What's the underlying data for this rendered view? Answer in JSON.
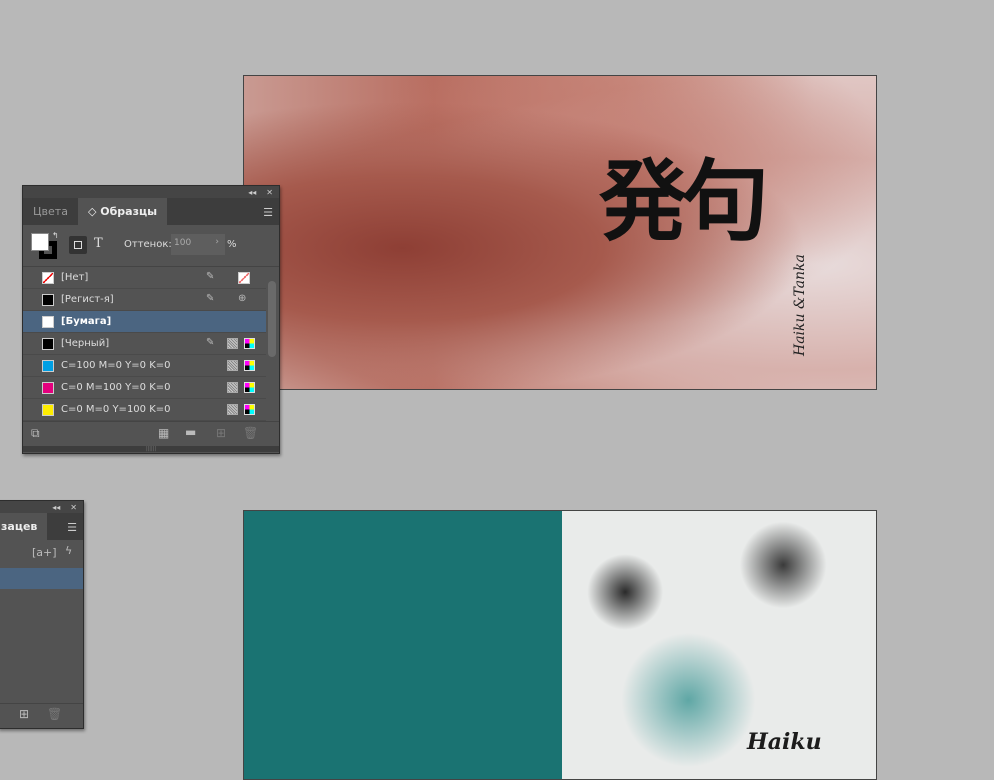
{
  "swatches_panel": {
    "tabs": [
      "Цвета",
      "Образцы"
    ],
    "tint_label": "Оттенок:",
    "tint_value": "100",
    "percent": "%",
    "swatches": [
      {
        "name": "[Нет]",
        "color": "none"
      },
      {
        "name": "[Регист-я]",
        "color": "#000000"
      },
      {
        "name": "[Бумага]",
        "color": "#ffffff",
        "selected": true
      },
      {
        "name": "[Черный]",
        "color": "#000000"
      },
      {
        "name": "C=100 M=0 Y=0 K=0",
        "color": "#009fe3"
      },
      {
        "name": "C=0 M=100 Y=0 K=0",
        "color": "#e5007e"
      },
      {
        "name": "C=0 M=0 Y=100 K=0",
        "color": "#ffed00"
      }
    ]
  },
  "paragraph_panel": {
    "tab": "зацев",
    "new_style_icon": "[a+]"
  },
  "artwork": {
    "kanji": "発句",
    "vertical_text": "Haiku &Tanka",
    "cover_text": "Haiku"
  }
}
